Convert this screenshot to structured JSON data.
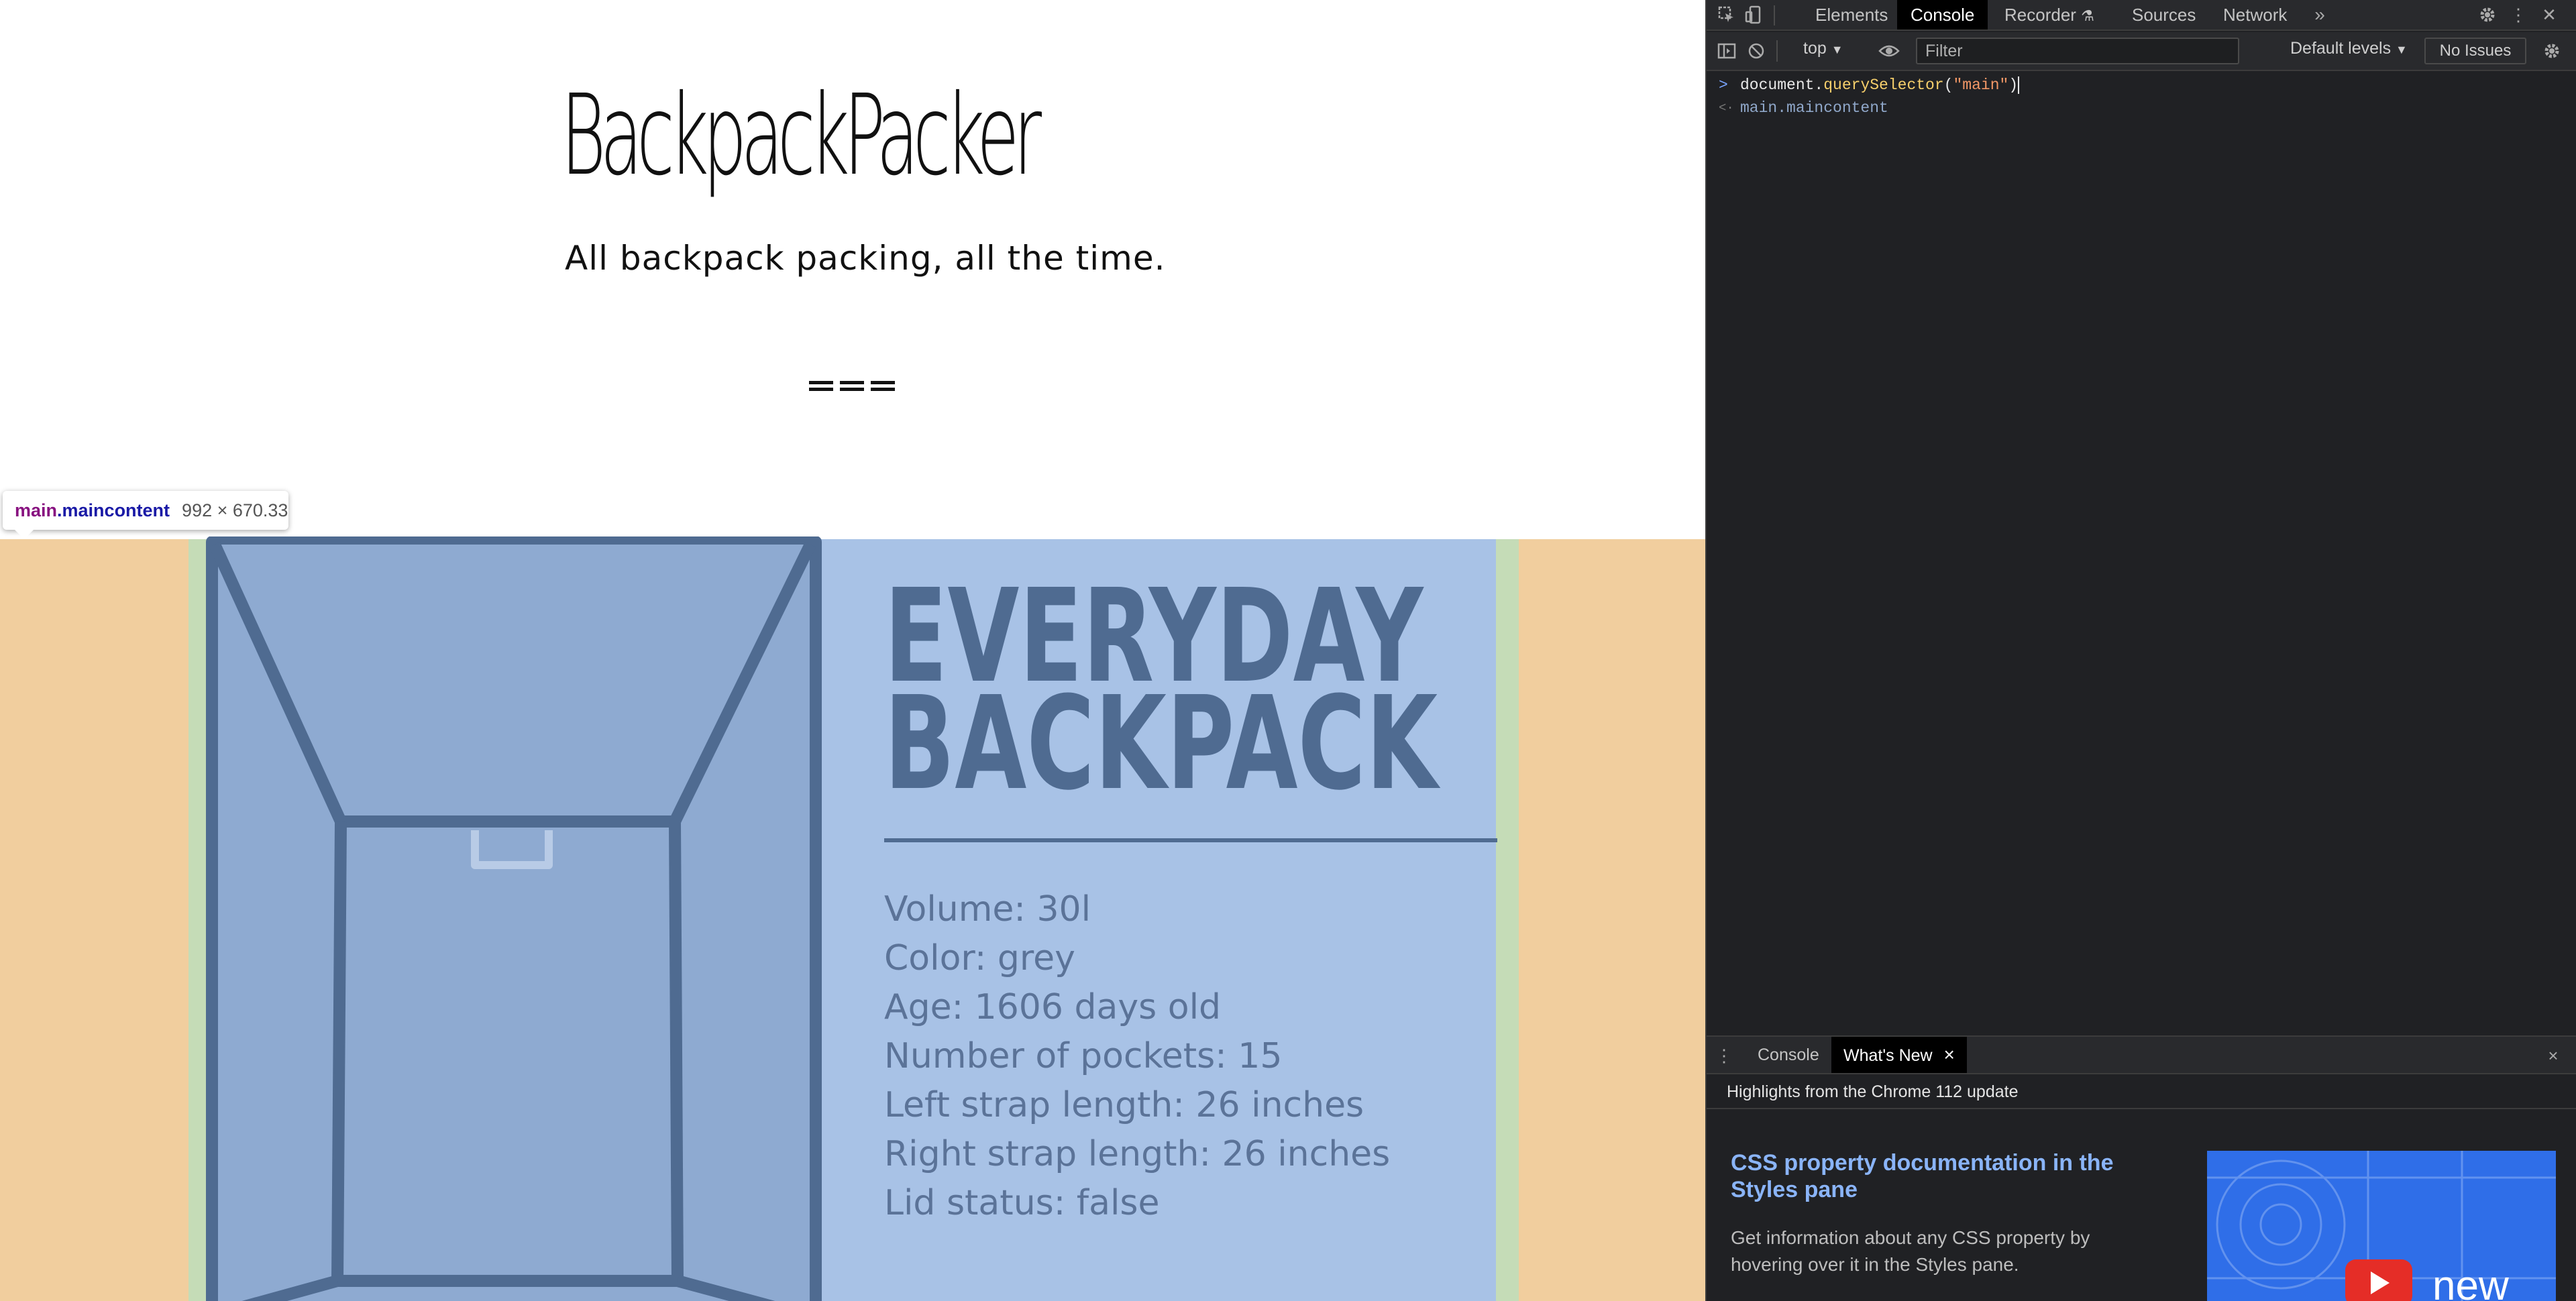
{
  "page": {
    "site_title": "BackpackPacker",
    "tagline": "All backpack packing, all the time.",
    "menu_icon": "hamburger-menu-icon"
  },
  "inspector_tooltip": {
    "tag": "main",
    "class": ".maincontent",
    "dimensions": "992 × 670.33"
  },
  "card": {
    "title": "EVERYDAY\nBACKPACK",
    "image_icon": "backpack-illustration",
    "specs": [
      "Volume: 30l",
      "Color: grey",
      "Age: 1606 days old",
      "Number of pockets: 15",
      "Left strap length: 26 inches",
      "Right strap length: 26 inches",
      "Lid status: false"
    ]
  },
  "devtools": {
    "tabs": [
      "Elements",
      "Console",
      "Recorder",
      "Sources",
      "Network"
    ],
    "active_tab": "Console",
    "more_tabs_icon": "chevron-double-right-icon",
    "toolbar": {
      "context": "top",
      "filter_placeholder": "Filter",
      "levels": "Default levels",
      "issues": "No Issues"
    },
    "console": {
      "input_prompt": ">",
      "result_prompt": "<·",
      "input_id": "document",
      "input_dot": ".",
      "input_fn": "querySelector",
      "input_open": "(",
      "input_str": "\"main\"",
      "input_close": ")",
      "result": "main.maincontent"
    },
    "drawer": {
      "tabs": [
        "Console",
        "What's New"
      ],
      "active_tab": "What's New",
      "close_tab": "×",
      "close_drawer": "×",
      "header": "Highlights from the Chrome 112 update",
      "card_title": "CSS property documentation in the Styles pane",
      "card_description": "Get information about any CSS property by hovering over it in the Styles pane.",
      "thumbnail_text": "new"
    }
  },
  "colors": {
    "highlight_padding": "#f1ce9e",
    "highlight_margin": "#c5dcb7",
    "card_bg": "#a8c2e6",
    "card_text": "#4f6b91",
    "devtools_bg": "#202124",
    "link_blue": "#8ab4f8"
  }
}
